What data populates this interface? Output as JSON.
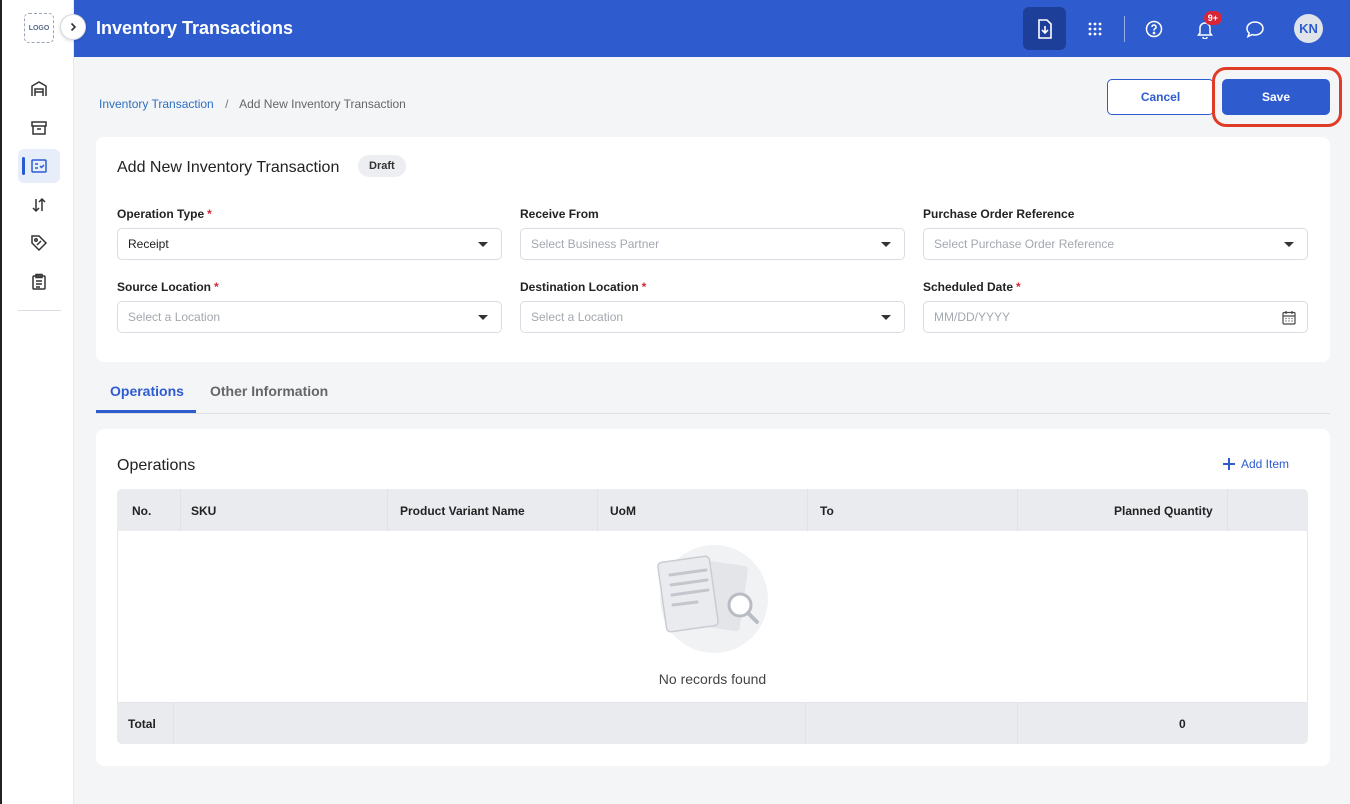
{
  "app": {
    "title": "Inventory Transactions",
    "logo_text": "LOGO"
  },
  "topbar": {
    "icons": [
      "download-icon",
      "apps-grid-icon",
      "help-icon",
      "bell-icon",
      "chat-icon"
    ],
    "notification_badge": "9+",
    "avatar_initials": "KN",
    "accent_color": "#2e5ccf"
  },
  "sidebar": {
    "items": [
      {
        "icon": "warehouse-icon"
      },
      {
        "icon": "archive-icon"
      },
      {
        "icon": "inventory-checklist-icon",
        "active": true
      },
      {
        "icon": "sort-arrows-icon"
      },
      {
        "icon": "tag-icon"
      },
      {
        "icon": "clipboard-icon"
      }
    ]
  },
  "breadcrumb": {
    "parent": "Inventory Transaction",
    "separator": "/",
    "current": "Add New Inventory Transaction"
  },
  "actions": {
    "cancel_label": "Cancel",
    "save_label": "Save"
  },
  "form": {
    "title": "Add New Inventory Transaction",
    "status": "Draft",
    "required_mark": "*",
    "fields": {
      "operation_type": {
        "label": "Operation Type",
        "value": "Receipt"
      },
      "receive_from": {
        "label": "Receive From",
        "placeholder": "Select Business Partner"
      },
      "po_reference": {
        "label": "Purchase Order Reference",
        "placeholder": "Select Purchase Order Reference"
      },
      "source_location": {
        "label": "Source Location",
        "placeholder": "Select a Location"
      },
      "destination_location": {
        "label": "Destination Location",
        "placeholder": "Select a Location"
      },
      "scheduled_date": {
        "label": "Scheduled Date",
        "placeholder": "MM/DD/YYYY"
      }
    }
  },
  "tabs": [
    {
      "label": "Operations",
      "active": true
    },
    {
      "label": "Other Information"
    }
  ],
  "operations": {
    "title": "Operations",
    "add_item_label": "Add Item",
    "columns": [
      "No.",
      "SKU",
      "Product Variant Name",
      "UoM",
      "To",
      "Planned Quantity"
    ],
    "empty_text": "No records found",
    "total_label": "Total",
    "total_value": "0"
  }
}
